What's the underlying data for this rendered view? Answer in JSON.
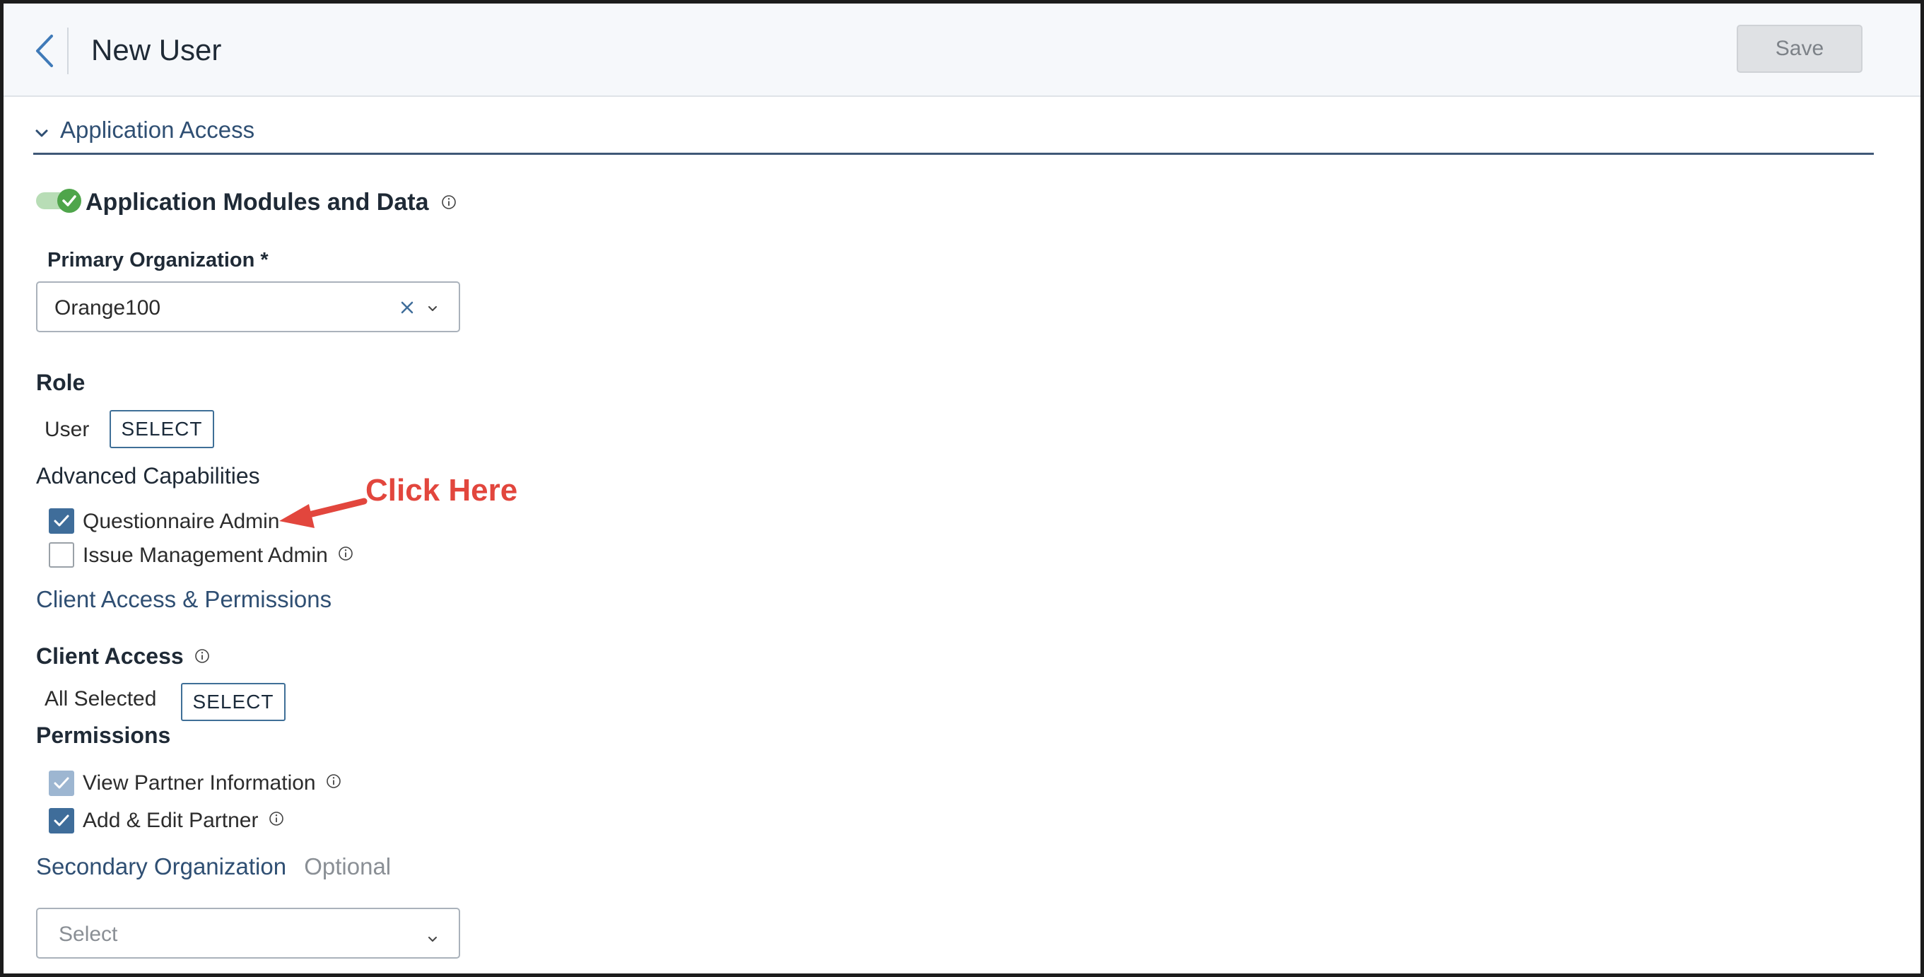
{
  "header": {
    "title": "New User",
    "save_label": "Save"
  },
  "section": {
    "title": "Application Access"
  },
  "modules": {
    "title": "Application Modules and Data",
    "toggle_on": true
  },
  "primary_org": {
    "label": "Primary Organization *",
    "value": "Orange100"
  },
  "role": {
    "label": "Role",
    "value": "User",
    "select_label": "SELECT"
  },
  "advanced": {
    "label": "Advanced Capabilities",
    "items": [
      {
        "label": "Questionnaire Admin",
        "checked": true
      },
      {
        "label": "Issue Management Admin",
        "checked": false
      }
    ]
  },
  "client_section": {
    "title": "Client Access & Permissions"
  },
  "client_access": {
    "label": "Client Access",
    "value": "All Selected",
    "select_label": "SELECT"
  },
  "permissions": {
    "label": "Permissions",
    "items": [
      {
        "label": "View Partner Information",
        "checked": true,
        "disabled": true
      },
      {
        "label": "Add & Edit Partner",
        "checked": true,
        "disabled": false
      }
    ]
  },
  "secondary_org": {
    "title": "Secondary Organization",
    "optional": "Optional",
    "placeholder": "Select"
  },
  "annotation": {
    "text": "Click Here",
    "color": "#e2463d"
  },
  "colors": {
    "accent": "#3f6d9a",
    "toggle_on": "#4fa54b",
    "section_title": "#2f4f73"
  }
}
